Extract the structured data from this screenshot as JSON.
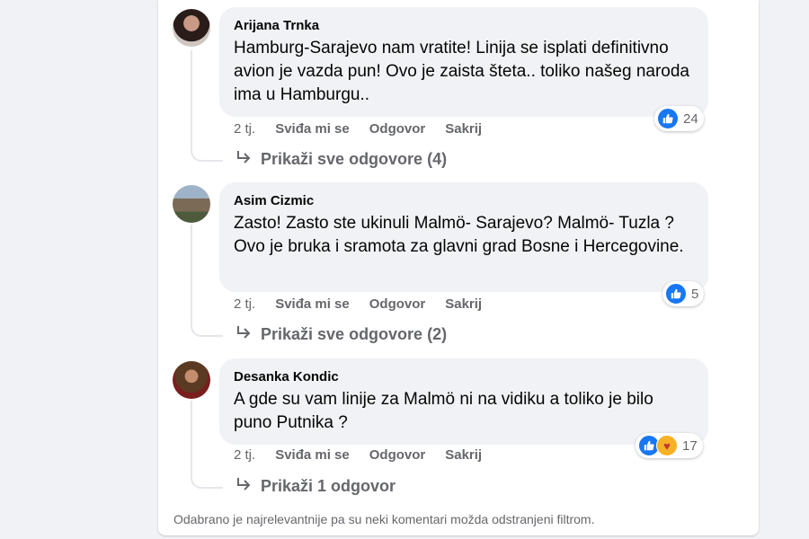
{
  "comments": [
    {
      "author": "Arijana Trnka",
      "text": "Hamburg-Sarajevo nam vratite! Linija se isplati definitivno avion je vazda pun! Ovo je zaista šteta.. toliko našeg naroda ima u Hamburgu..",
      "time": "2 tj.",
      "like_label": "Sviđa mi se",
      "reply_label": "Odgovor",
      "hide_label": "Sakrij",
      "reaction_count": "24",
      "replies_label": "Prikaži sve odgovore (4)"
    },
    {
      "author": "Asim Cizmic",
      "text": "Zasto! Zasto ste ukinuli Malmö- Sarajevo? Malmö- Tuzla ? Ovo je bruka i sramota za glavni grad Bosne i Hercegovine.",
      "time": "2 tj.",
      "like_label": "Sviđa mi se",
      "reply_label": "Odgovor",
      "hide_label": "Sakrij",
      "reaction_count": "5",
      "replies_label": "Prikaži sve odgovore (2)"
    },
    {
      "author": "Desanka Kondic",
      "text": "A gde su vam linije za Malmö ni na vidiku a toliko je bilo puno Putnika ?",
      "time": "2 tj.",
      "like_label": "Sviđa mi se",
      "reply_label": "Odgovor",
      "hide_label": "Sakrij",
      "reaction_count": "17",
      "replies_label": "Prikaži 1 odgovor"
    }
  ],
  "footer_note": "Odabrano je najrelevantnije pa su neki komentari možda odstranjeni filtrom.",
  "colors": {
    "like_blue": "#1877f2",
    "care_yellow": "#f7b125",
    "bubble_gray": "#f0f2f5",
    "muted_text": "#65676b"
  },
  "icons": [
    "like-icon",
    "care-icon",
    "reply-arrow-icon"
  ]
}
